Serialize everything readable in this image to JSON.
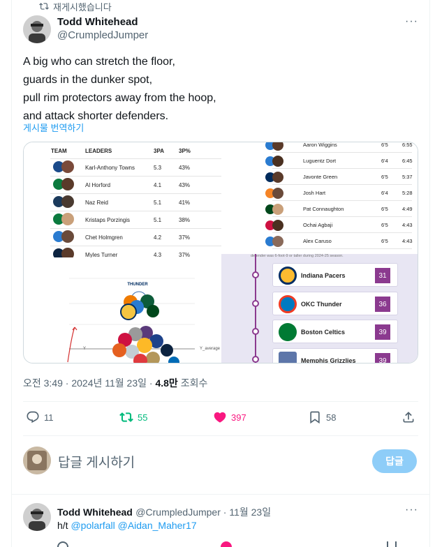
{
  "retweet": {
    "label": "재게시했습니다"
  },
  "tweet": {
    "author_name": "Todd Whitehead",
    "author_handle": "@CrumpledJumper",
    "text_lines": [
      "A big who can stretch the floor,",
      "guards in the dunker spot,",
      "pull rim protectors away from the hoop,",
      "and attack shorter defenders."
    ],
    "translate_label": "게시물 번역하기",
    "timestamp": "오전 3:49 · 2024년 11월 23일",
    "dot": " · ",
    "views_count": "4.8만",
    "views_label": " 조회수"
  },
  "media": {
    "left_table": {
      "headers": [
        "TEAM",
        "LEADERS",
        "3PA",
        "3P%"
      ],
      "rows": [
        {
          "leader": "Karl-Anthony Towns",
          "pa": "5.3",
          "pct": "43%"
        },
        {
          "leader": "Al Horford",
          "pa": "4.1",
          "pct": "43%"
        },
        {
          "leader": "Naz Reid",
          "pa": "5.1",
          "pct": "41%"
        },
        {
          "leader": "Kristaps Porzingis",
          "pa": "5.1",
          "pct": "38%"
        },
        {
          "leader": "Chet Holmgren",
          "pa": "4.2",
          "pct": "37%"
        },
        {
          "leader": "Myles Turner",
          "pa": "4.3",
          "pct": "37%"
        }
      ]
    },
    "right_table": {
      "rows": [
        {
          "name": "Aaron Wiggins",
          "height": "6'5",
          "time": "6:55"
        },
        {
          "name": "Luguentz Dort",
          "height": "6'4",
          "time": "6:45"
        },
        {
          "name": "Javonte Green",
          "height": "6'5",
          "time": "5:37"
        },
        {
          "name": "Josh Hart",
          "height": "6'4",
          "time": "5:28"
        },
        {
          "name": "Pat Connaughton",
          "height": "6'5",
          "time": "4:49"
        },
        {
          "name": "Ochai Agbaji",
          "height": "6'5",
          "time": "4:43"
        },
        {
          "name": "Alex Caruso",
          "height": "6'5",
          "time": "4:43"
        }
      ]
    },
    "plot": {
      "avg_label": "Y_average",
      "y_label": "Y"
    },
    "timeline": {
      "caption": "defender was 6-foot-9 or taller during 2024-25 season.",
      "teams": [
        {
          "name": "Indiana Pacers",
          "value": "31"
        },
        {
          "name": "OKC Thunder",
          "value": "36"
        },
        {
          "name": "Boston Celtics",
          "value": "39"
        },
        {
          "name": "Memphis Grizzlies",
          "value": "39"
        }
      ]
    }
  },
  "actions": {
    "replies": "11",
    "reposts": "55",
    "likes": "397"
  },
  "actions_extra": {
    "bookmarks": "58"
  },
  "reply_box": {
    "placeholder": "답글 게시하기",
    "button": "답글"
  },
  "reply": {
    "author_name": "Todd Whitehead",
    "author_handle": "@CrumpledJumper",
    "date": " · 11월 23일",
    "text_prefix": "h/t ",
    "mention1": "@polarfall",
    "mention2": "@Aidan_Maher17"
  },
  "colors": {
    "accent": "#1d9bf0",
    "repost_green": "#00ba7c",
    "like_pink": "#f91880",
    "muted": "#536471",
    "reply_button": "#8ecdf8",
    "timeline_purple": "#8b3a8f"
  }
}
